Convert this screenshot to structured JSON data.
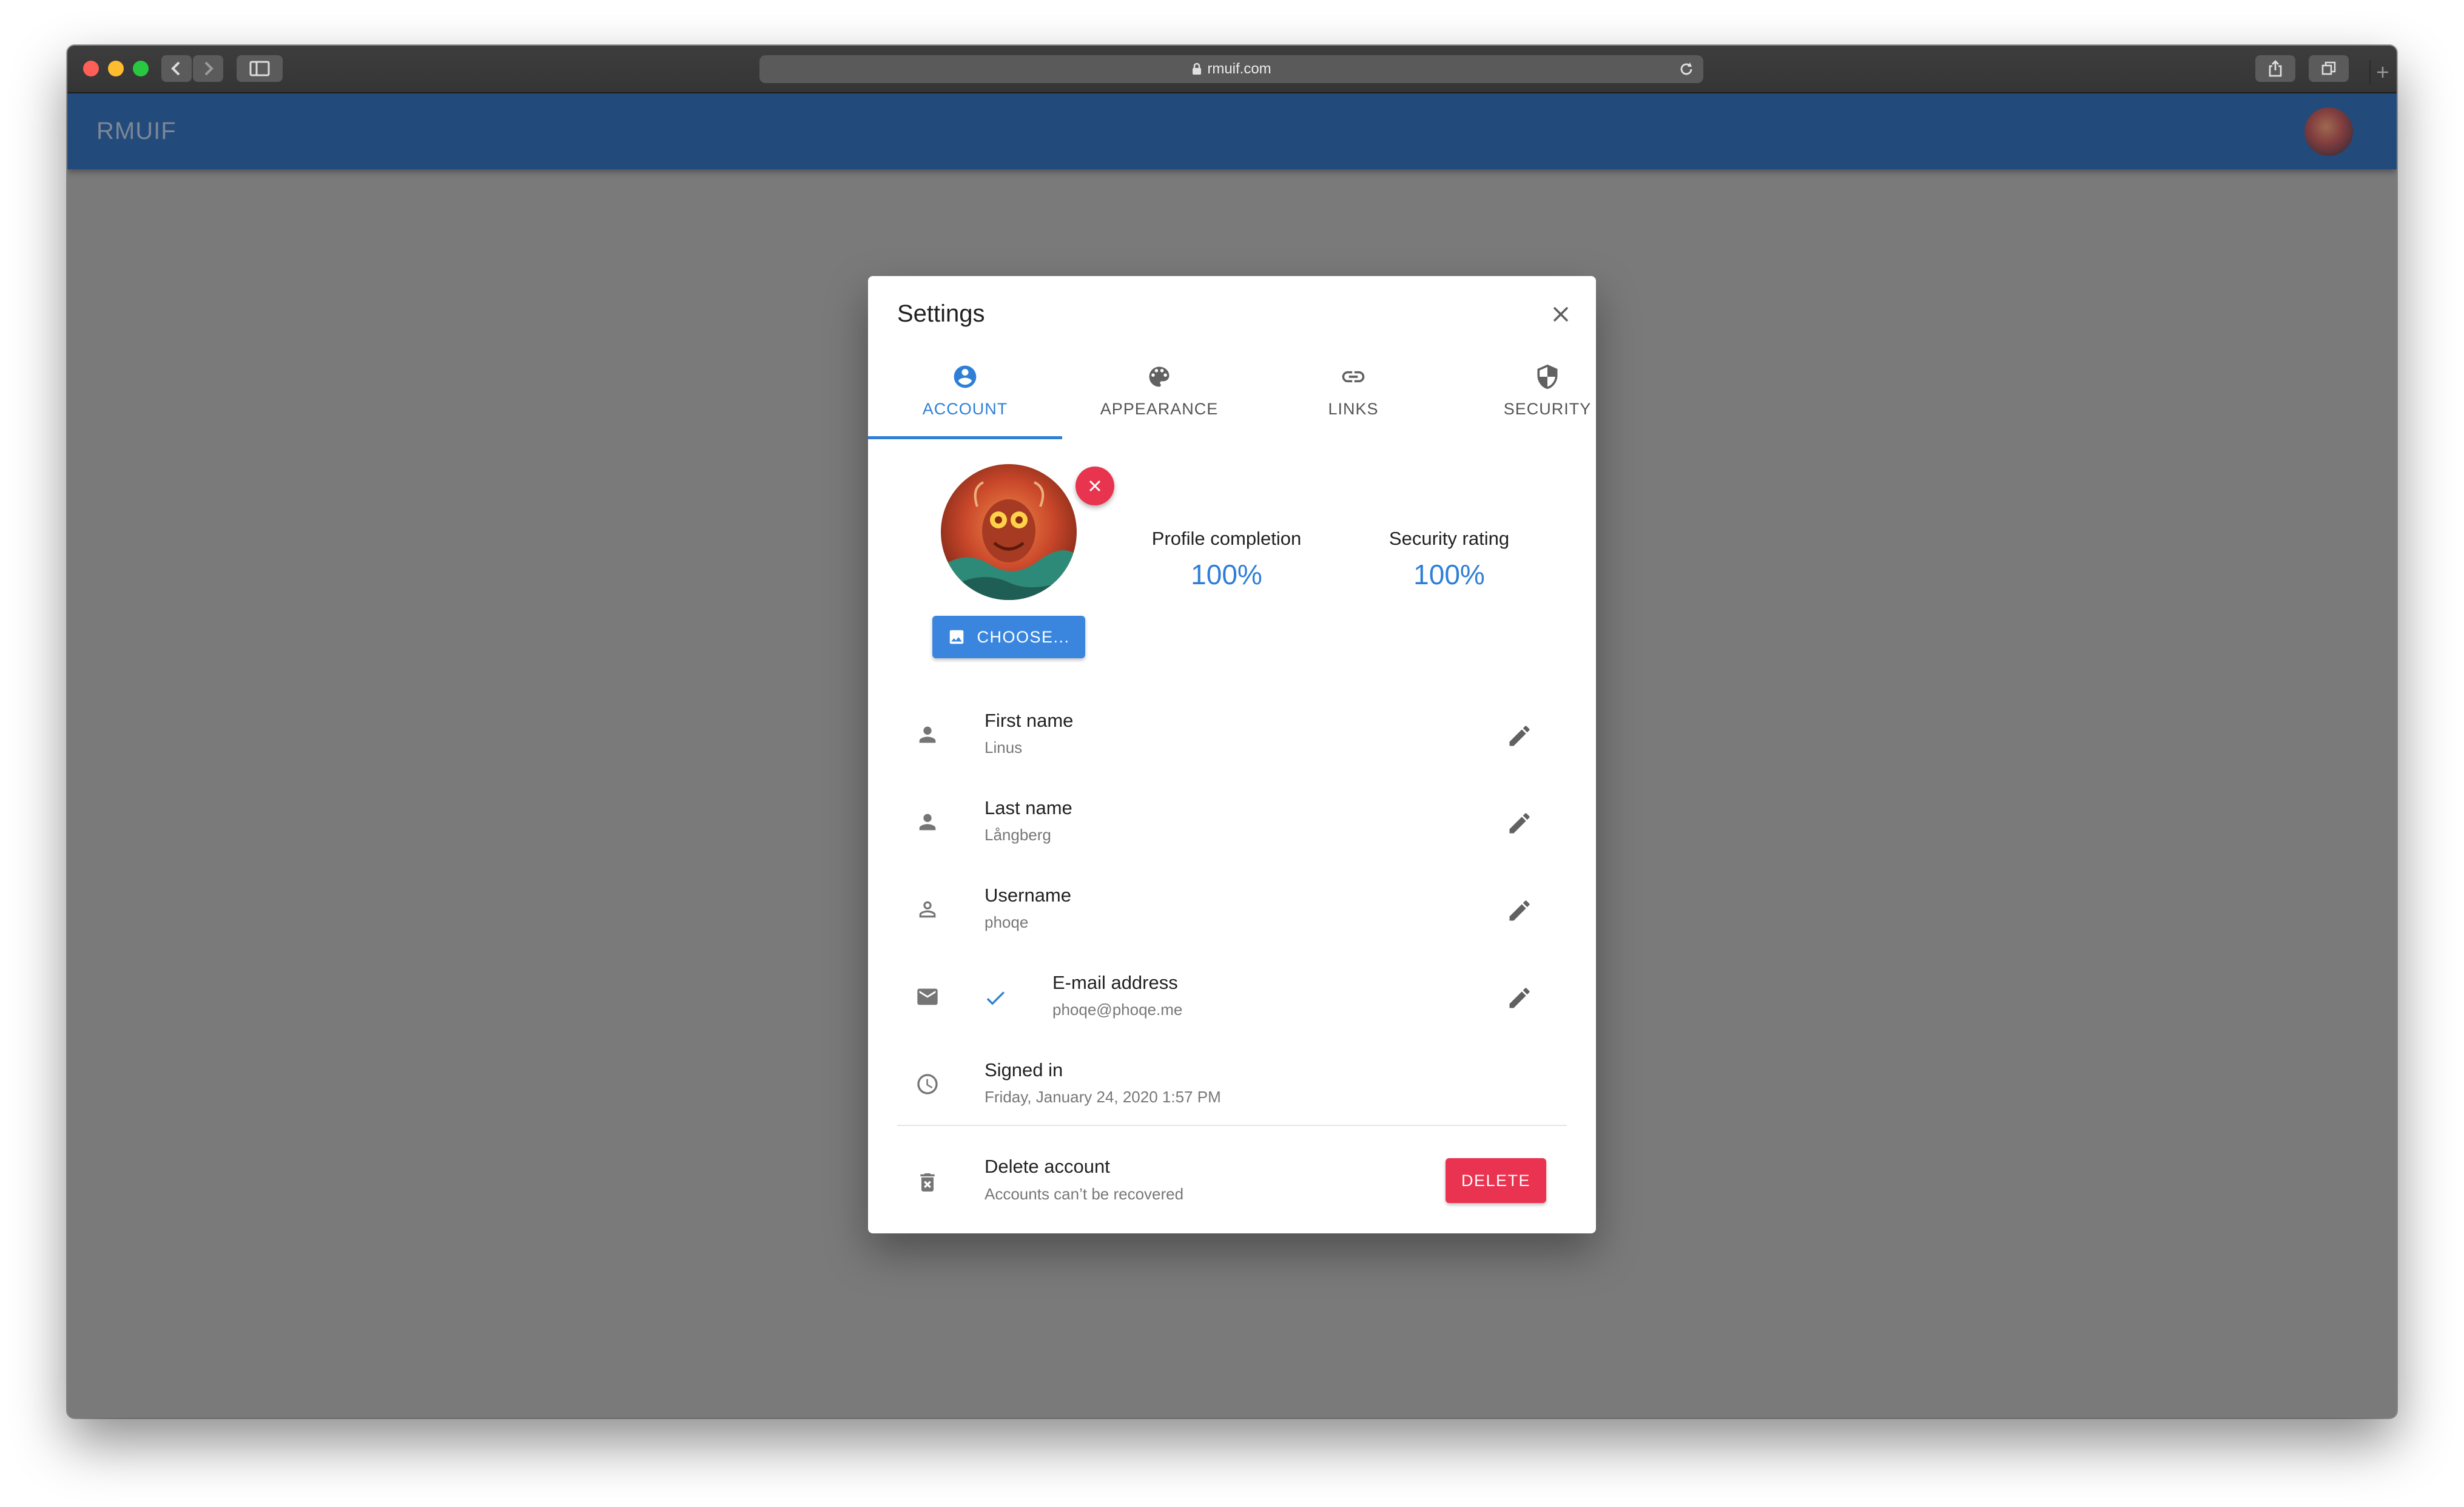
{
  "browser": {
    "url": "rmuif.com"
  },
  "app": {
    "title": "RMUIF"
  },
  "dialog": {
    "title": "Settings",
    "tabs": [
      {
        "label": "ACCOUNT",
        "icon": "account-circle-icon",
        "active": true
      },
      {
        "label": "APPEARANCE",
        "icon": "palette-icon",
        "active": false
      },
      {
        "label": "LINKS",
        "icon": "link-icon",
        "active": false
      },
      {
        "label": "SECURITY",
        "icon": "security-shield-icon",
        "active": false
      }
    ],
    "choose_label": "CHOOSE...",
    "stats": {
      "profile_completion": {
        "label": "Profile completion",
        "value": "100%"
      },
      "security_rating": {
        "label": "Security rating",
        "value": "100%"
      }
    },
    "fields": {
      "first_name": {
        "label": "First name",
        "value": "Linus"
      },
      "last_name": {
        "label": "Last name",
        "value": "Långberg"
      },
      "username": {
        "label": "Username",
        "value": "phoqe"
      },
      "email": {
        "label": "E-mail address",
        "value": "phoqe@phoqe.me",
        "verified": true
      },
      "signed_in": {
        "label": "Signed in",
        "value": "Friday, January 24, 2020 1:57 PM"
      }
    },
    "delete_account": {
      "label": "Delete account",
      "description": "Accounts can’t be recovered",
      "button": "DELETE"
    }
  },
  "colors": {
    "appbar": "#224a7b",
    "accent": "#2f7fd7",
    "danger": "#ea3350",
    "overlay": "#7a7a7a"
  }
}
